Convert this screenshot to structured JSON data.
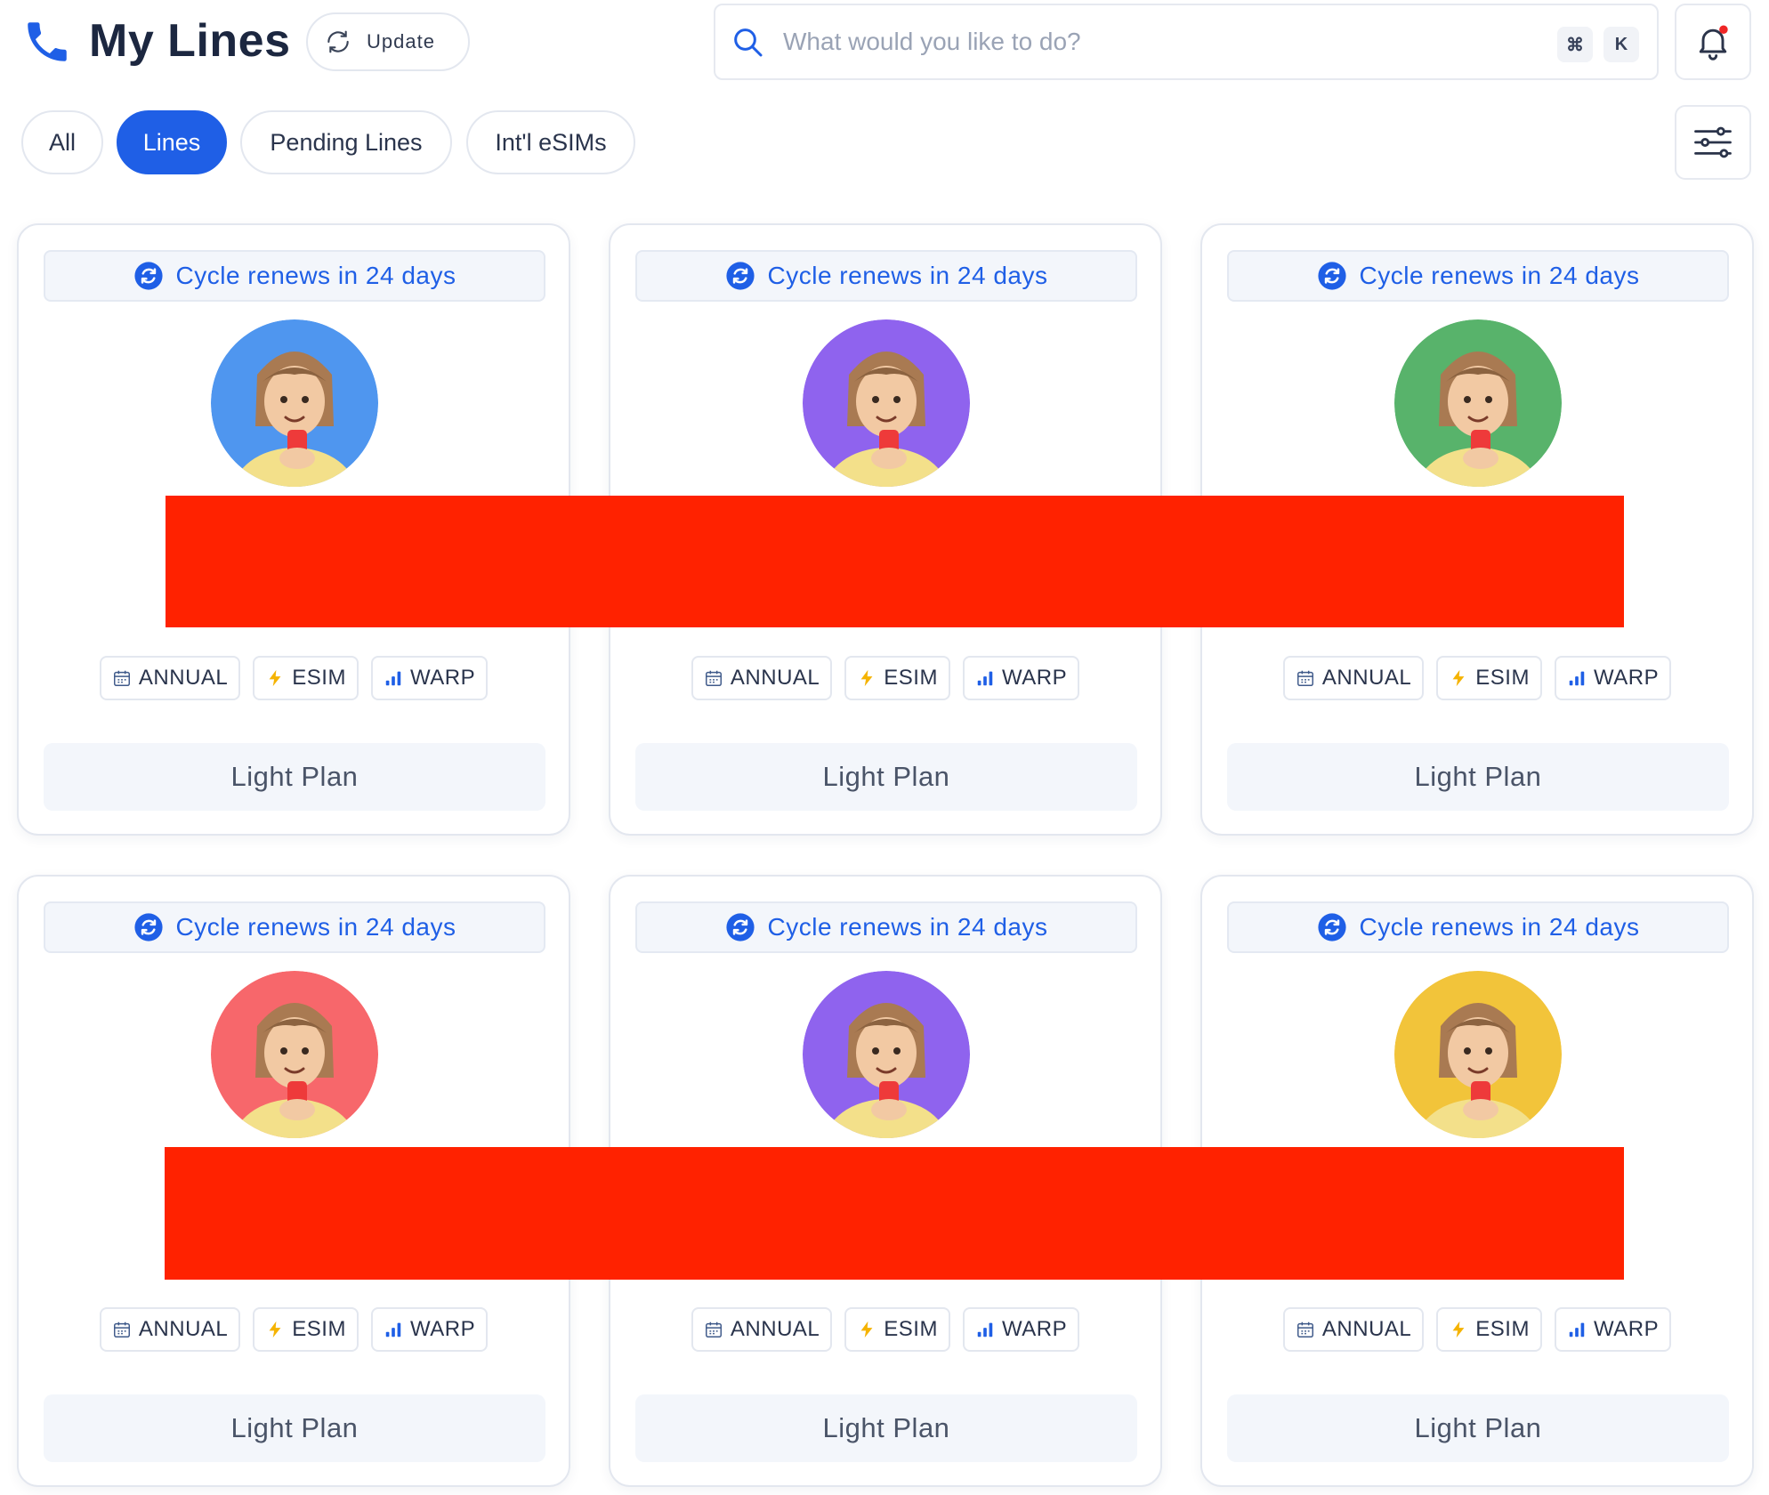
{
  "header": {
    "title": "My Lines",
    "update_label": "Update",
    "search_placeholder": "What would you like to do?",
    "shortcut_keys": [
      "⌘",
      "K"
    ]
  },
  "tabs": [
    {
      "label": "All",
      "active": false
    },
    {
      "label": "Lines",
      "active": true
    },
    {
      "label": "Pending Lines",
      "active": false
    },
    {
      "label": "Int'l eSIMs",
      "active": false
    }
  ],
  "colors": {
    "accent": "#1f5fe6",
    "redaction": "#ff2200",
    "esim_bolt": "#f5b301"
  },
  "lines": [
    {
      "cycle_text": "Cycle renews in 24 days",
      "avatar_bg": "#4f96ef",
      "tags": [
        "ANNUAL",
        "ESIM",
        "WARP"
      ],
      "plan": "Light Plan"
    },
    {
      "cycle_text": "Cycle renews in 24 days",
      "avatar_bg": "#8f63ee",
      "tags": [
        "ANNUAL",
        "ESIM",
        "WARP"
      ],
      "plan": "Light Plan"
    },
    {
      "cycle_text": "Cycle renews in 24 days",
      "avatar_bg": "#58b36b",
      "tags": [
        "ANNUAL",
        "ESIM",
        "WARP"
      ],
      "plan": "Light Plan"
    },
    {
      "cycle_text": "Cycle renews in 24 days",
      "avatar_bg": "#f7676b",
      "tags": [
        "ANNUAL",
        "ESIM",
        "WARP"
      ],
      "plan": "Light Plan"
    },
    {
      "cycle_text": "Cycle renews in 24 days",
      "avatar_bg": "#8f63ee",
      "tags": [
        "ANNUAL",
        "ESIM",
        "WARP"
      ],
      "plan": "Light Plan"
    },
    {
      "cycle_text": "Cycle renews in 24 days",
      "avatar_bg": "#f2c43a",
      "tags": [
        "ANNUAL",
        "ESIM",
        "WARP"
      ],
      "plan": "Light Plan"
    }
  ]
}
